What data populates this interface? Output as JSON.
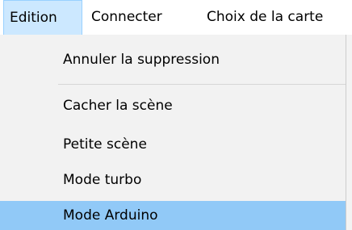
{
  "menubar": {
    "items": [
      "Edition",
      "Connecter",
      "Choix de la carte"
    ]
  },
  "dropdown": {
    "items": [
      "Annuler la suppression",
      "Cacher la scène",
      "Petite scène",
      "Mode turbo",
      "Mode Arduino"
    ],
    "highlighted": "Mode Arduino"
  },
  "colors": {
    "active_menu_bg": "#cce8ff",
    "highlight_bg": "#91c9f7",
    "menu_bg": "#f2f2f2"
  }
}
